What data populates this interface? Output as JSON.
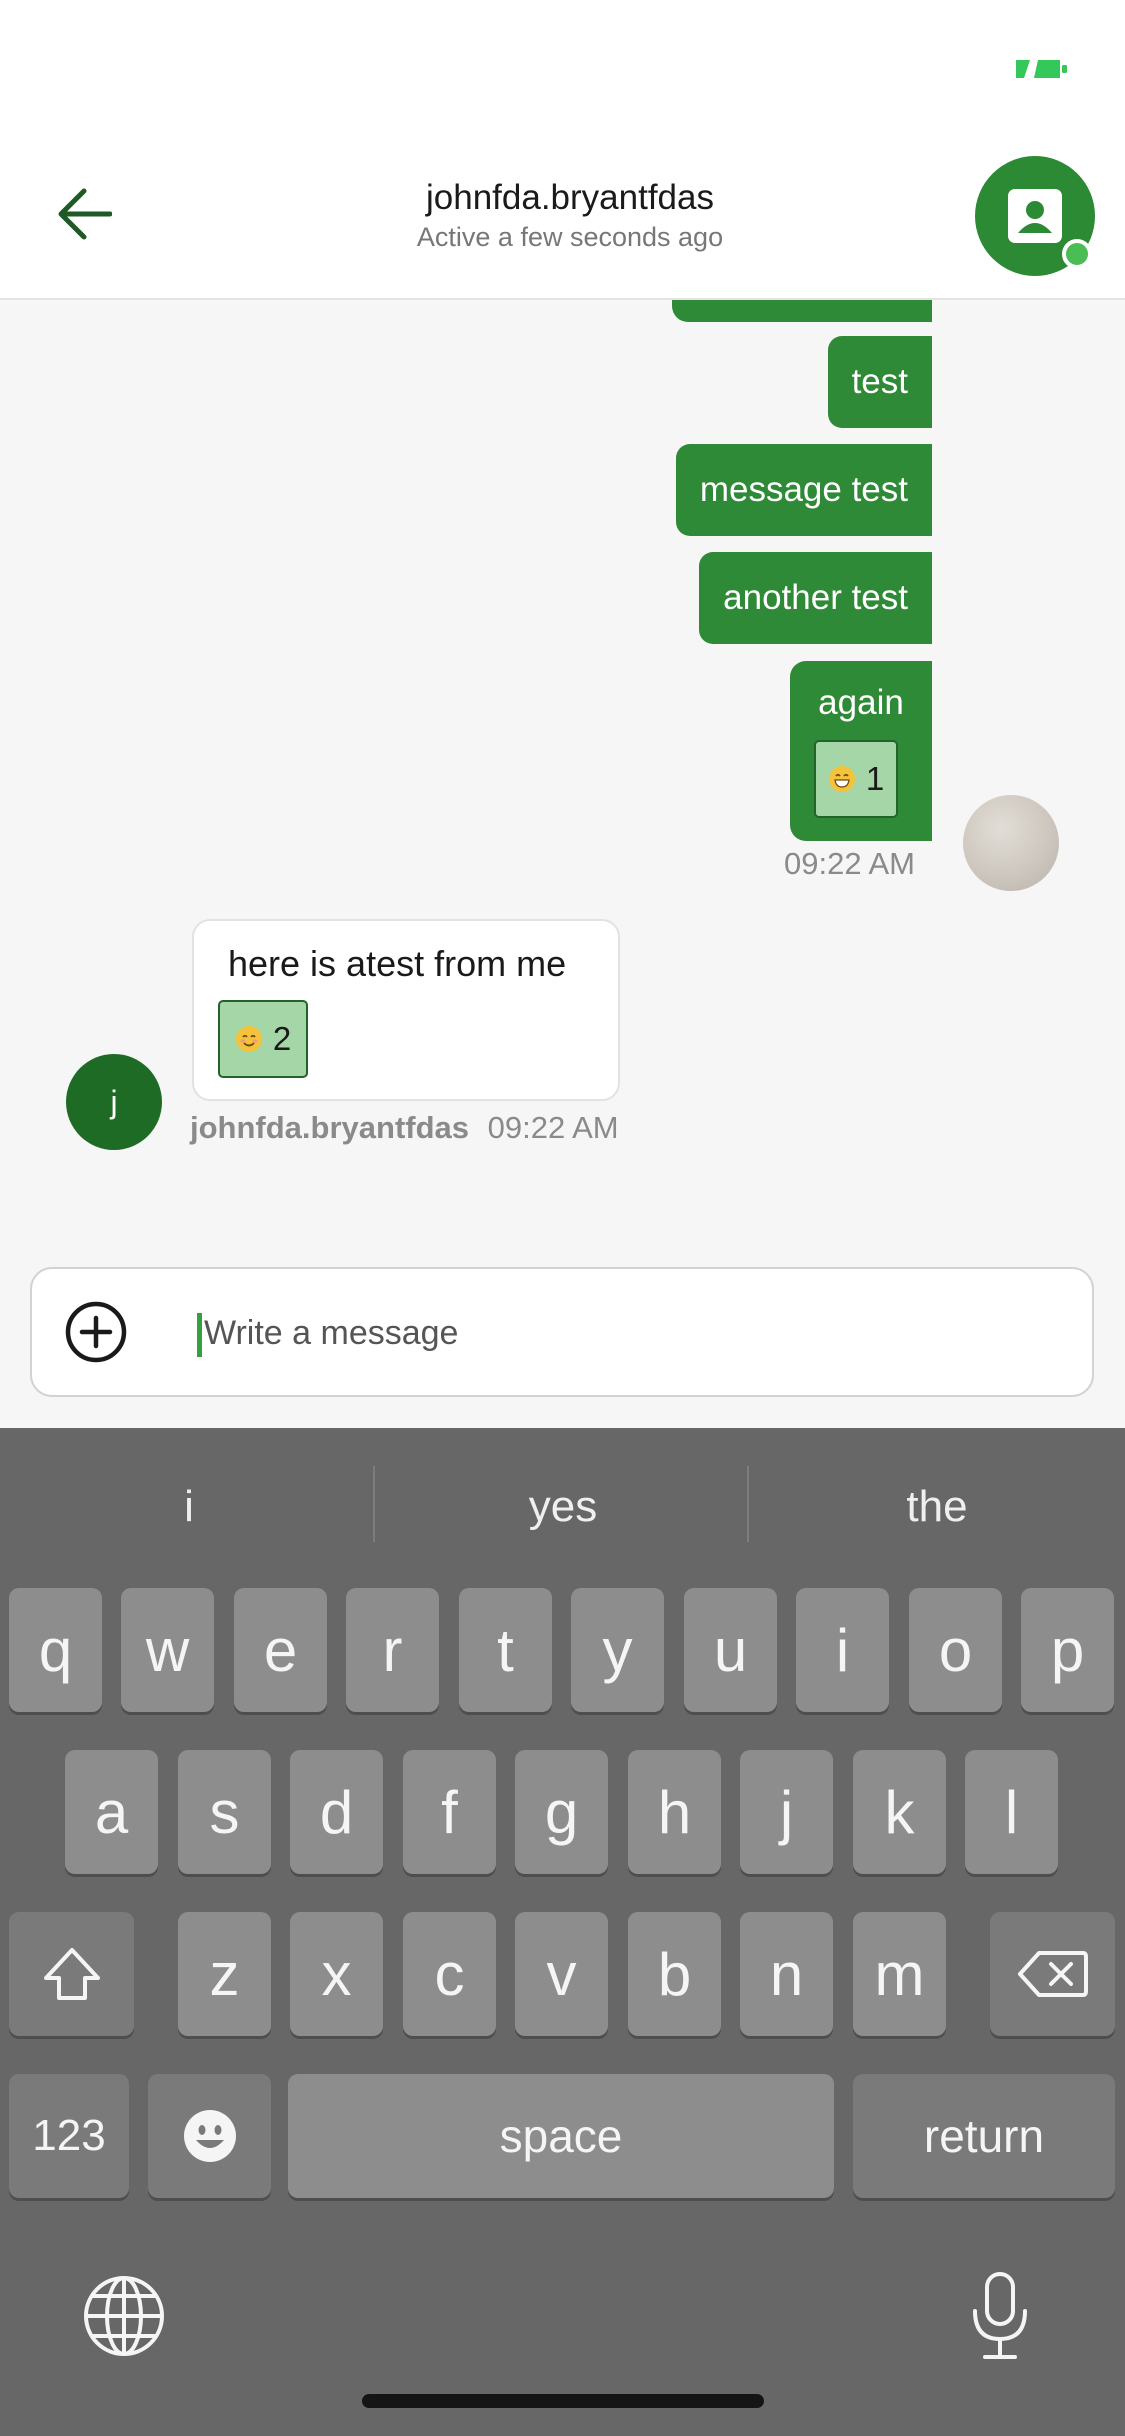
{
  "header": {
    "title": "johnfda.bryantfdas",
    "status": "Active a few seconds ago"
  },
  "messages_out": [
    {
      "text": "test"
    },
    {
      "text": "message test"
    },
    {
      "text": "another test"
    },
    {
      "text": "again",
      "reaction_count": "1",
      "reaction_emoji": "grinning-face",
      "time": "09:22 AM"
    }
  ],
  "message_in": {
    "text": "here is atest from me",
    "reaction_count": "2",
    "reaction_emoji": "smiling-face",
    "avatar_initial": "j",
    "sender": "johnfda.bryantfdas",
    "time": "09:22 AM"
  },
  "composer": {
    "placeholder": "Write a message"
  },
  "keyboard": {
    "suggestions": [
      "i",
      "yes",
      "the"
    ],
    "row1": [
      "q",
      "w",
      "e",
      "r",
      "t",
      "y",
      "u",
      "i",
      "o",
      "p"
    ],
    "row2": [
      "a",
      "s",
      "d",
      "f",
      "g",
      "h",
      "j",
      "k",
      "l"
    ],
    "row3": [
      "z",
      "x",
      "c",
      "v",
      "b",
      "n",
      "m"
    ],
    "numbers_label": "123",
    "space_label": "space",
    "return_label": "return"
  },
  "colors": {
    "brand_green": "#2e8a36",
    "reaction_bg": "#a5d6a7",
    "keyboard_bg": "#676767"
  }
}
